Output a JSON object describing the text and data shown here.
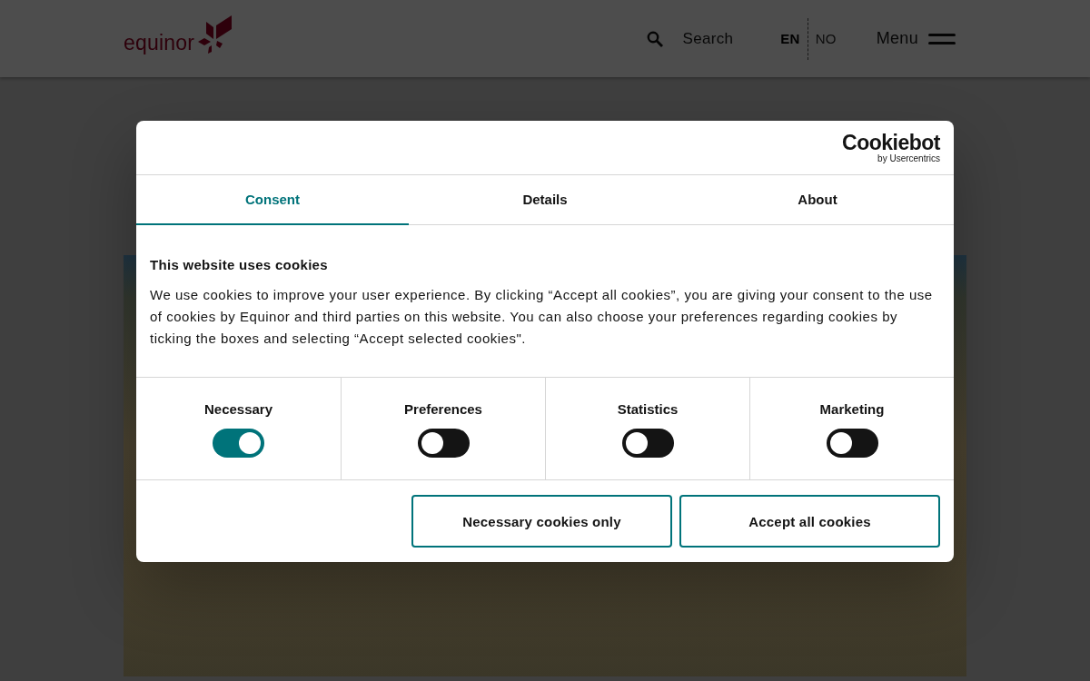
{
  "header": {
    "logo_text": "equinor",
    "search": {
      "label": "Search"
    },
    "languages": [
      {
        "label": "EN",
        "selected": true
      },
      {
        "label": "NO",
        "selected": false
      }
    ],
    "menu": {
      "label": "Menu"
    }
  },
  "dialog": {
    "brand": {
      "name": "Cookiebot",
      "byline": "by Usercentrics"
    },
    "tabs": [
      {
        "label": "Consent",
        "selected": true
      },
      {
        "label": "Details",
        "selected": false
      },
      {
        "label": "About",
        "selected": false
      }
    ],
    "title": "This website uses cookies",
    "body": "We use cookies to improve your user experience. By clicking “Accept all cookies”, you are giving your consent to the use of cookies by Equinor and third parties on this website. You can also choose your preferences regarding cookies by ticking the boxes and selecting “Accept selected cookies\".",
    "categories": [
      {
        "label": "Necessary",
        "on": true
      },
      {
        "label": "Preferences",
        "on": false
      },
      {
        "label": "Statistics",
        "on": false
      },
      {
        "label": "Marketing",
        "on": false
      }
    ],
    "buttons": [
      {
        "label": "Necessary cookies only"
      },
      {
        "label": "Accept all cookies"
      }
    ]
  }
}
